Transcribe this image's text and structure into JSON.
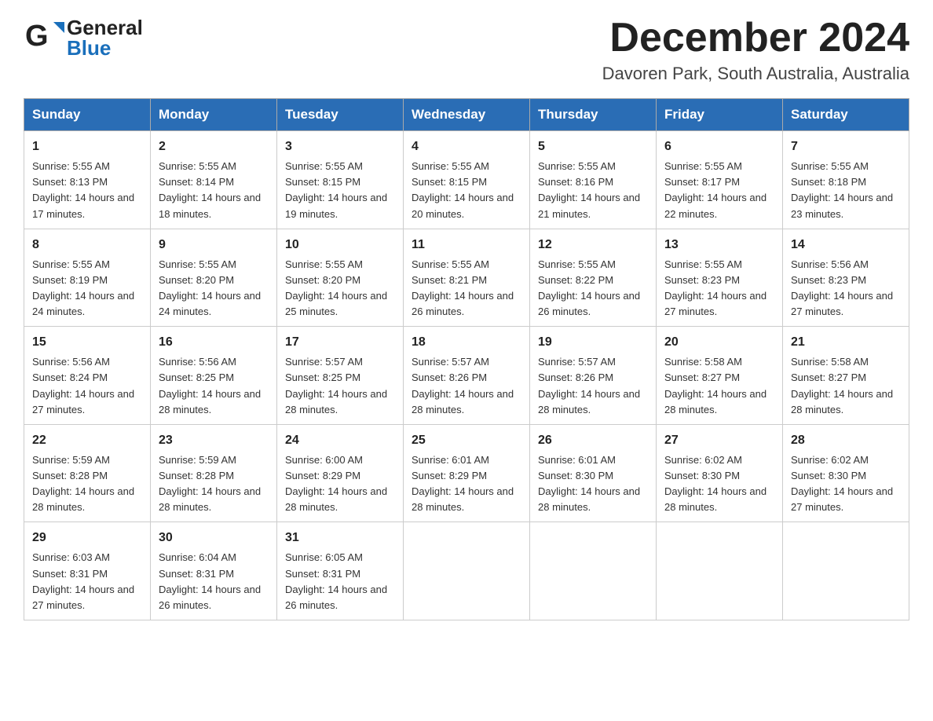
{
  "header": {
    "logo_general": "General",
    "logo_blue": "Blue",
    "month_title": "December 2024",
    "location": "Davoren Park, South Australia, Australia"
  },
  "weekdays": [
    "Sunday",
    "Monday",
    "Tuesday",
    "Wednesday",
    "Thursday",
    "Friday",
    "Saturday"
  ],
  "weeks": [
    [
      {
        "day": "1",
        "sunrise": "5:55 AM",
        "sunset": "8:13 PM",
        "daylight": "14 hours and 17 minutes."
      },
      {
        "day": "2",
        "sunrise": "5:55 AM",
        "sunset": "8:14 PM",
        "daylight": "14 hours and 18 minutes."
      },
      {
        "day": "3",
        "sunrise": "5:55 AM",
        "sunset": "8:15 PM",
        "daylight": "14 hours and 19 minutes."
      },
      {
        "day": "4",
        "sunrise": "5:55 AM",
        "sunset": "8:15 PM",
        "daylight": "14 hours and 20 minutes."
      },
      {
        "day": "5",
        "sunrise": "5:55 AM",
        "sunset": "8:16 PM",
        "daylight": "14 hours and 21 minutes."
      },
      {
        "day": "6",
        "sunrise": "5:55 AM",
        "sunset": "8:17 PM",
        "daylight": "14 hours and 22 minutes."
      },
      {
        "day": "7",
        "sunrise": "5:55 AM",
        "sunset": "8:18 PM",
        "daylight": "14 hours and 23 minutes."
      }
    ],
    [
      {
        "day": "8",
        "sunrise": "5:55 AM",
        "sunset": "8:19 PM",
        "daylight": "14 hours and 24 minutes."
      },
      {
        "day": "9",
        "sunrise": "5:55 AM",
        "sunset": "8:20 PM",
        "daylight": "14 hours and 24 minutes."
      },
      {
        "day": "10",
        "sunrise": "5:55 AM",
        "sunset": "8:20 PM",
        "daylight": "14 hours and 25 minutes."
      },
      {
        "day": "11",
        "sunrise": "5:55 AM",
        "sunset": "8:21 PM",
        "daylight": "14 hours and 26 minutes."
      },
      {
        "day": "12",
        "sunrise": "5:55 AM",
        "sunset": "8:22 PM",
        "daylight": "14 hours and 26 minutes."
      },
      {
        "day": "13",
        "sunrise": "5:55 AM",
        "sunset": "8:23 PM",
        "daylight": "14 hours and 27 minutes."
      },
      {
        "day": "14",
        "sunrise": "5:56 AM",
        "sunset": "8:23 PM",
        "daylight": "14 hours and 27 minutes."
      }
    ],
    [
      {
        "day": "15",
        "sunrise": "5:56 AM",
        "sunset": "8:24 PM",
        "daylight": "14 hours and 27 minutes."
      },
      {
        "day": "16",
        "sunrise": "5:56 AM",
        "sunset": "8:25 PM",
        "daylight": "14 hours and 28 minutes."
      },
      {
        "day": "17",
        "sunrise": "5:57 AM",
        "sunset": "8:25 PM",
        "daylight": "14 hours and 28 minutes."
      },
      {
        "day": "18",
        "sunrise": "5:57 AM",
        "sunset": "8:26 PM",
        "daylight": "14 hours and 28 minutes."
      },
      {
        "day": "19",
        "sunrise": "5:57 AM",
        "sunset": "8:26 PM",
        "daylight": "14 hours and 28 minutes."
      },
      {
        "day": "20",
        "sunrise": "5:58 AM",
        "sunset": "8:27 PM",
        "daylight": "14 hours and 28 minutes."
      },
      {
        "day": "21",
        "sunrise": "5:58 AM",
        "sunset": "8:27 PM",
        "daylight": "14 hours and 28 minutes."
      }
    ],
    [
      {
        "day": "22",
        "sunrise": "5:59 AM",
        "sunset": "8:28 PM",
        "daylight": "14 hours and 28 minutes."
      },
      {
        "day": "23",
        "sunrise": "5:59 AM",
        "sunset": "8:28 PM",
        "daylight": "14 hours and 28 minutes."
      },
      {
        "day": "24",
        "sunrise": "6:00 AM",
        "sunset": "8:29 PM",
        "daylight": "14 hours and 28 minutes."
      },
      {
        "day": "25",
        "sunrise": "6:01 AM",
        "sunset": "8:29 PM",
        "daylight": "14 hours and 28 minutes."
      },
      {
        "day": "26",
        "sunrise": "6:01 AM",
        "sunset": "8:30 PM",
        "daylight": "14 hours and 28 minutes."
      },
      {
        "day": "27",
        "sunrise": "6:02 AM",
        "sunset": "8:30 PM",
        "daylight": "14 hours and 28 minutes."
      },
      {
        "day": "28",
        "sunrise": "6:02 AM",
        "sunset": "8:30 PM",
        "daylight": "14 hours and 27 minutes."
      }
    ],
    [
      {
        "day": "29",
        "sunrise": "6:03 AM",
        "sunset": "8:31 PM",
        "daylight": "14 hours and 27 minutes."
      },
      {
        "day": "30",
        "sunrise": "6:04 AM",
        "sunset": "8:31 PM",
        "daylight": "14 hours and 26 minutes."
      },
      {
        "day": "31",
        "sunrise": "6:05 AM",
        "sunset": "8:31 PM",
        "daylight": "14 hours and 26 minutes."
      },
      null,
      null,
      null,
      null
    ]
  ]
}
